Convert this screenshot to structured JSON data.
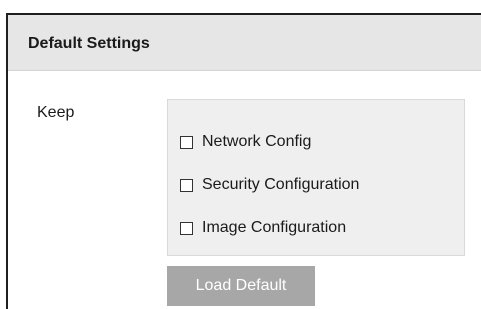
{
  "panel": {
    "title": "Default Settings"
  },
  "keep": {
    "label": "Keep",
    "options": [
      {
        "label": "Network Config",
        "checked": false
      },
      {
        "label": "Security Configuration",
        "checked": false
      },
      {
        "label": "Image Configuration",
        "checked": false
      }
    ]
  },
  "actions": {
    "load_default_label": "Load Default"
  },
  "colors": {
    "header_bg": "#e6e6e6",
    "options_bg": "#efefef",
    "button_bg": "#a7a7a7",
    "button_text": "#ffffff"
  }
}
